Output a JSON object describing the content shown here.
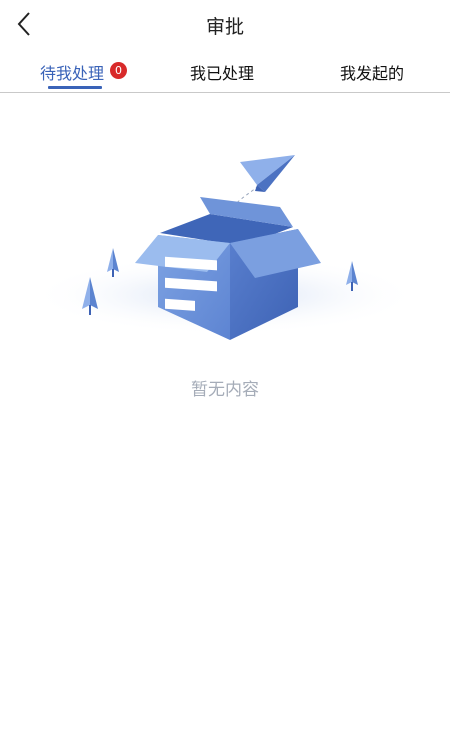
{
  "header": {
    "title": "审批",
    "back_icon": "chevron-left-icon"
  },
  "tabs": [
    {
      "label": "待我处理",
      "badge": "0",
      "active": true
    },
    {
      "label": "我已处理",
      "active": false
    },
    {
      "label": "我发起的",
      "active": false
    }
  ],
  "empty_state": {
    "illustration": "empty-box-paper-plane-icon",
    "message": "暂无内容"
  },
  "colors": {
    "accent": "#3a63b8",
    "badge": "#d82a2a",
    "empty_text": "#a5acb8",
    "illustration_blue": "#5b86d4"
  }
}
